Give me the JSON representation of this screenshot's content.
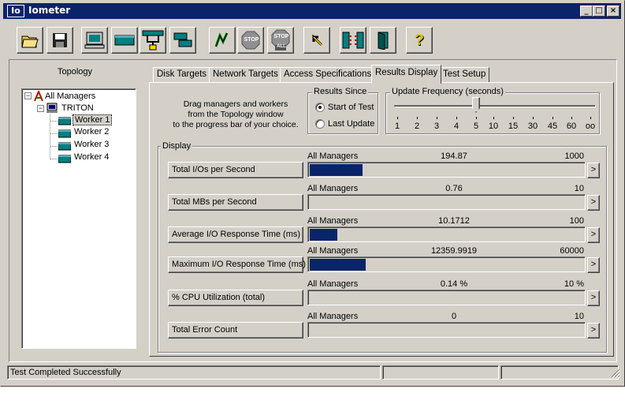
{
  "window": {
    "title": "Iometer",
    "app_icon_text": "Io"
  },
  "titlebar_buttons": {
    "minimize": "_",
    "maximize": "□",
    "close": "×"
  },
  "toolbar": {
    "items": [
      {
        "name": "open-config-icon"
      },
      {
        "name": "save-config-icon"
      },
      {
        "name": "start-display-icon"
      },
      {
        "name": "new-disk-worker-icon"
      },
      {
        "name": "new-network-worker-icon"
      },
      {
        "name": "duplicate-worker-icon"
      },
      {
        "name": "start-tests-icon"
      },
      {
        "name": "stop-icon",
        "text": "STOP"
      },
      {
        "name": "stop-all-icon",
        "text": "STOP",
        "sub": "ALL"
      },
      {
        "name": "reset-workers-icon"
      },
      {
        "name": "disconnect-managers-icon"
      },
      {
        "name": "exit-icon"
      },
      {
        "name": "help-icon",
        "text": "?"
      }
    ]
  },
  "topology": {
    "title": "Topology",
    "root": "All Managers",
    "manager": "TRITON",
    "workers": [
      "Worker 1",
      "Worker 2",
      "Worker 3",
      "Worker 4"
    ],
    "tree_toggle": "−"
  },
  "tabs": [
    {
      "label": "Disk Targets"
    },
    {
      "label": "Network Targets"
    },
    {
      "label": "Access Specifications"
    },
    {
      "label": "Results Display",
      "active": true
    },
    {
      "label": "Test Setup"
    }
  ],
  "results": {
    "instructions": [
      "Drag managers and workers",
      "from the Topology window",
      "to the progress bar of your choice."
    ],
    "results_since": {
      "title": "Results Since",
      "options": [
        "Start of Test",
        "Last Update"
      ],
      "selected": "Start of Test"
    },
    "update_frequency": {
      "title": "Update Frequency (seconds)",
      "ticks": [
        "1",
        "2",
        "3",
        "4",
        "5",
        "10",
        "15",
        "30",
        "45",
        "60",
        "oo"
      ],
      "selected": "5"
    },
    "display_title": "Display",
    "more_button": ">",
    "metrics": [
      {
        "label": "Total I/Os per Second",
        "source": "All Managers",
        "value": "194.87",
        "max": "1000",
        "fraction": 0.1949
      },
      {
        "label": "Total MBs per Second",
        "source": "All Managers",
        "value": "0.76",
        "max": "10",
        "fraction": 0.0
      },
      {
        "label": "Average I/O Response Time (ms)",
        "source": "All Managers",
        "value": "10.1712",
        "max": "100",
        "fraction": 0.1017
      },
      {
        "label": "Maximum I/O Response Time (ms)",
        "source": "All Managers",
        "value": "12359.9919",
        "max": "60000",
        "fraction": 0.206
      },
      {
        "label": "% CPU Utilization (total)",
        "source": "All Managers",
        "value": "0.14 %",
        "max": "10 %",
        "fraction": 0.0
      },
      {
        "label": "Total Error Count",
        "source": "All Managers",
        "value": "0",
        "max": "10",
        "fraction": 0.0
      }
    ]
  },
  "status": {
    "text": "Test Completed Successfully"
  },
  "colors": {
    "titlebar": "#0a246a",
    "face": "#d4d0c8",
    "bar": "#0a246a"
  }
}
